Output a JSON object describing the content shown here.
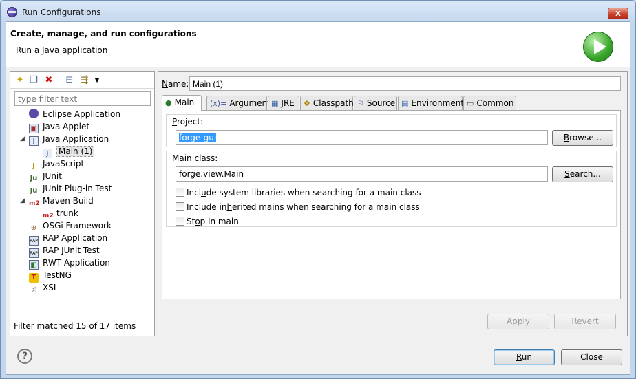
{
  "window": {
    "title": "Run Configurations",
    "close_glyph": "x"
  },
  "header": {
    "title": "Create, manage, and run configurations",
    "subtitle": "Run a Java application"
  },
  "left": {
    "filter_placeholder": "type filter text",
    "status": "Filter matched 15 of 17 items",
    "tree": [
      {
        "label": "Eclipse Application",
        "icon": "eclipse-icon"
      },
      {
        "label": "Java Applet",
        "icon": "applet-icon"
      },
      {
        "label": "Java Application",
        "icon": "java-app-icon",
        "expanded": true
      },
      {
        "label": "Main (1)",
        "icon": "java-app-icon",
        "selected": true
      },
      {
        "label": "JavaScript",
        "icon": "javascript-icon"
      },
      {
        "label": "JUnit",
        "icon": "junit-icon"
      },
      {
        "label": "JUnit Plug-in Test",
        "icon": "junit-plugin-icon"
      },
      {
        "label": "Maven Build",
        "icon": "maven-icon",
        "expanded": true
      },
      {
        "label": "trunk",
        "icon": "maven-icon"
      },
      {
        "label": "OSGi Framework",
        "icon": "osgi-icon"
      },
      {
        "label": "RAP Application",
        "icon": "rap-icon"
      },
      {
        "label": "RAP JUnit Test",
        "icon": "rap-junit-icon"
      },
      {
        "label": "RWT Application",
        "icon": "rwt-icon"
      },
      {
        "label": "TestNG",
        "icon": "testng-icon"
      },
      {
        "label": "XSL",
        "icon": "xsl-icon"
      }
    ]
  },
  "right": {
    "name_label": "Name:",
    "name_value": "Main (1)",
    "tabs": [
      {
        "label": "Main",
        "icon": "main-tab-icon"
      },
      {
        "label": "Arguments",
        "icon": "arguments-icon"
      },
      {
        "label": "JRE",
        "icon": "jre-icon"
      },
      {
        "label": "Classpath",
        "icon": "classpath-icon"
      },
      {
        "label": "Source",
        "icon": "source-icon"
      },
      {
        "label": "Environment",
        "icon": "environment-icon"
      },
      {
        "label": "Common",
        "icon": "common-icon"
      }
    ],
    "project_label": "Project:",
    "project_value": "forge-gui",
    "browse_label": "Browse...",
    "main_class_label": "Main class:",
    "main_class_value": "forge.view.Main",
    "search_label": "Search...",
    "checkboxes": [
      "Include system libraries when searching for a main class",
      "Include inherited mains when searching for a main class",
      "Stop in main"
    ],
    "apply_label": "Apply",
    "revert_label": "Revert"
  },
  "footer": {
    "run_label": "Run",
    "close_label": "Close",
    "help_glyph": "?"
  }
}
